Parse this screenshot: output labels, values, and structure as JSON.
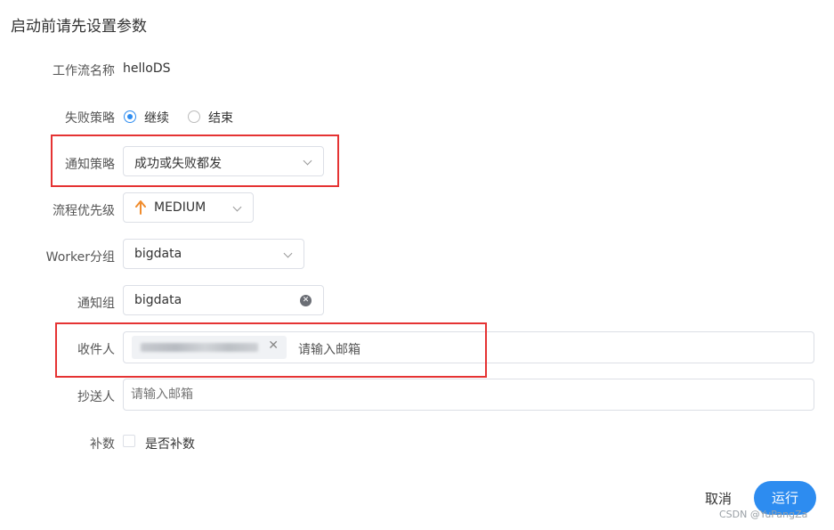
{
  "dialog": {
    "title": "启动前请先设置参数"
  },
  "workflow_name": {
    "label": "工作流名称",
    "value": "helloDS"
  },
  "failure_strategy": {
    "label": "失败策略",
    "options": [
      "继续",
      "结束"
    ],
    "selected": "继续"
  },
  "notify_strategy": {
    "label": "通知策略",
    "value": "成功或失败都发"
  },
  "process_priority": {
    "label": "流程优先级",
    "value": "MEDIUM",
    "icon": "arrow-up-icon",
    "color": "#f08c2d"
  },
  "worker_group": {
    "label": "Worker分组",
    "value": "bigdata"
  },
  "notify_group": {
    "label": "通知组",
    "value": "bigdata"
  },
  "recipients": {
    "label": "收件人",
    "tag_remove": "✕",
    "placeholder": "请输入邮箱"
  },
  "cc": {
    "label": "抄送人",
    "placeholder": "请输入邮箱"
  },
  "complement": {
    "label": "补数",
    "checkbox_label": "是否补数",
    "checked": false
  },
  "actions": {
    "cancel": "取消",
    "run": "运行"
  },
  "watermark": "CSDN @YuPangZa",
  "colors": {
    "primary": "#2d8cf0",
    "highlight": "#e53333",
    "priority": "#f08c2d"
  }
}
